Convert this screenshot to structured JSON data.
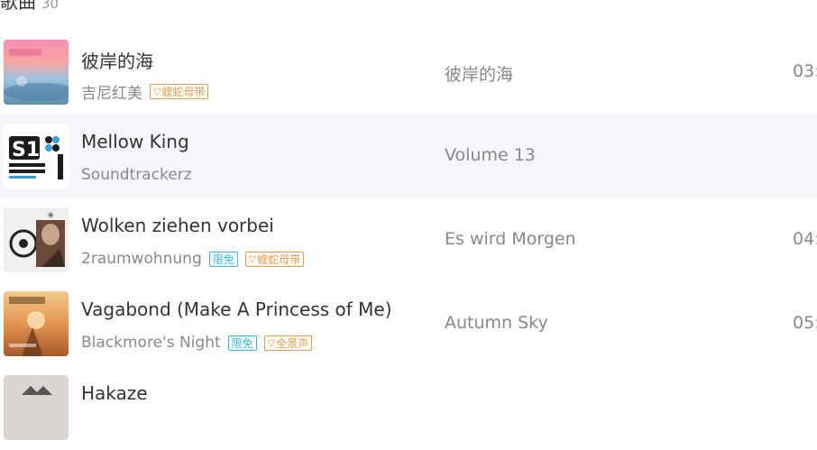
{
  "section": {
    "title": "歌曲",
    "count": "30"
  },
  "songs": [
    {
      "title": "彼岸的海",
      "artist": "吉尼红美",
      "tags": [
        {
          "type": "quality",
          "label": "蝰蛇母带"
        }
      ],
      "album": "彼岸的海",
      "duration": "03:"
    },
    {
      "title": "Mellow King",
      "artist": "Soundtrackerz",
      "tags": [],
      "album": "Volume 13",
      "duration": ""
    },
    {
      "title": "Wolken ziehen vorbei",
      "artist": "2raumwohnung",
      "tags": [
        {
          "type": "limited",
          "label": "限免"
        },
        {
          "type": "quality",
          "label": "蝰蛇母带"
        }
      ],
      "album": "Es wird Morgen",
      "duration": "04:"
    },
    {
      "title": "Vagabond (Make A Princess of Me)",
      "artist": "Blackmore's Night",
      "tags": [
        {
          "type": "limited",
          "label": "限免"
        },
        {
          "type": "quality",
          "label": "全景声"
        }
      ],
      "album": "Autumn Sky",
      "duration": "05:"
    },
    {
      "title": "Hakaze",
      "artist": "",
      "tags": [],
      "album": "",
      "duration": ""
    }
  ],
  "colors": {
    "highlight_row": "#f4f6fa",
    "limited_tag": "#39b6e8",
    "quality_tag": "#e89a4a",
    "title_text": "#333333",
    "secondary_text": "#888888"
  }
}
